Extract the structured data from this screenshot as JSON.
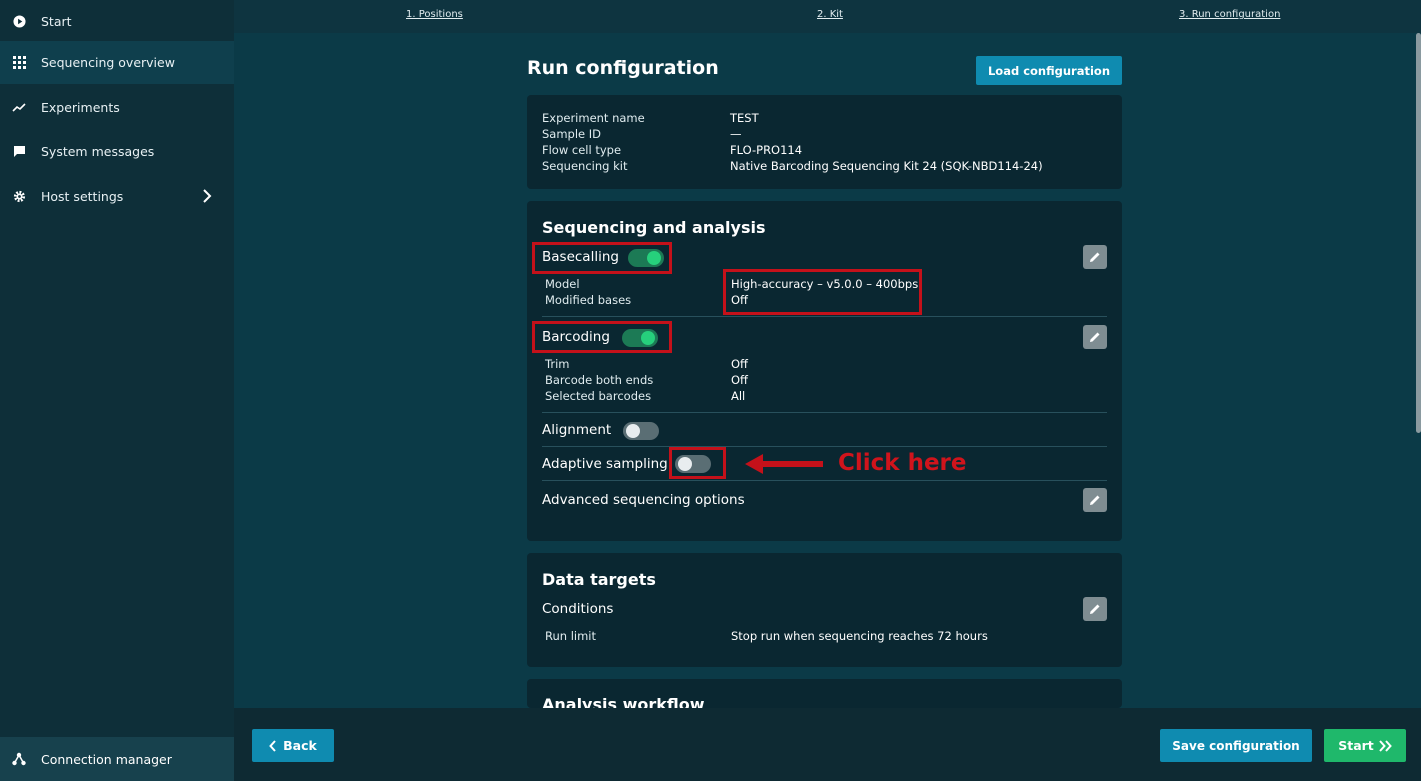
{
  "sidebar": {
    "items": [
      {
        "label": "Start",
        "icon": "play-circle-icon"
      },
      {
        "label": "Sequencing overview",
        "icon": "grid-icon"
      },
      {
        "label": "Experiments",
        "icon": "trend-line-icon"
      },
      {
        "label": "System messages",
        "icon": "message-icon"
      },
      {
        "label": "Host settings",
        "icon": "gear-icon"
      }
    ],
    "connection_label": "Connection manager"
  },
  "stepper": {
    "steps": [
      "1. Positions",
      "2. Kit",
      "3. Run configuration"
    ]
  },
  "page": {
    "title": "Run configuration",
    "load_button": "Load configuration"
  },
  "summary": {
    "rows": [
      {
        "label": "Experiment name",
        "value": "TEST"
      },
      {
        "label": "Sample ID",
        "value": "—"
      },
      {
        "label": "Flow cell type",
        "value": "FLO-PRO114"
      },
      {
        "label": "Sequencing kit",
        "value": "Native Barcoding Sequencing Kit 24 (SQK-NBD114-24)"
      }
    ]
  },
  "analysis": {
    "title": "Sequencing and analysis",
    "basecalling": {
      "label": "Basecalling",
      "enabled": true,
      "rows": [
        {
          "label": "Model",
          "value": "High-accuracy – v5.0.0 – 400bps"
        },
        {
          "label": "Modified bases",
          "value": "Off"
        }
      ]
    },
    "barcoding": {
      "label": "Barcoding",
      "enabled": true,
      "rows": [
        {
          "label": "Trim",
          "value": "Off"
        },
        {
          "label": "Barcode both ends",
          "value": "Off"
        },
        {
          "label": "Selected barcodes",
          "value": "All"
        }
      ]
    },
    "alignment": {
      "label": "Alignment",
      "enabled": false
    },
    "adaptive_sampling": {
      "label": "Adaptive sampling",
      "enabled": false
    },
    "advanced": {
      "label": "Advanced sequencing options"
    },
    "annotation": "Click here"
  },
  "targets": {
    "title": "Data targets",
    "conditions_label": "Conditions",
    "run_limit_label": "Run limit",
    "run_limit_value": "Stop run when sequencing reaches 72 hours"
  },
  "workflow": {
    "title": "Analysis workflow"
  },
  "footer": {
    "back": "Back",
    "save": "Save configuration",
    "start": "Start"
  },
  "colors": {
    "accent_blue": "#0f8bb0",
    "accent_green": "#1fb86b",
    "highlight_red": "#c4111a"
  }
}
